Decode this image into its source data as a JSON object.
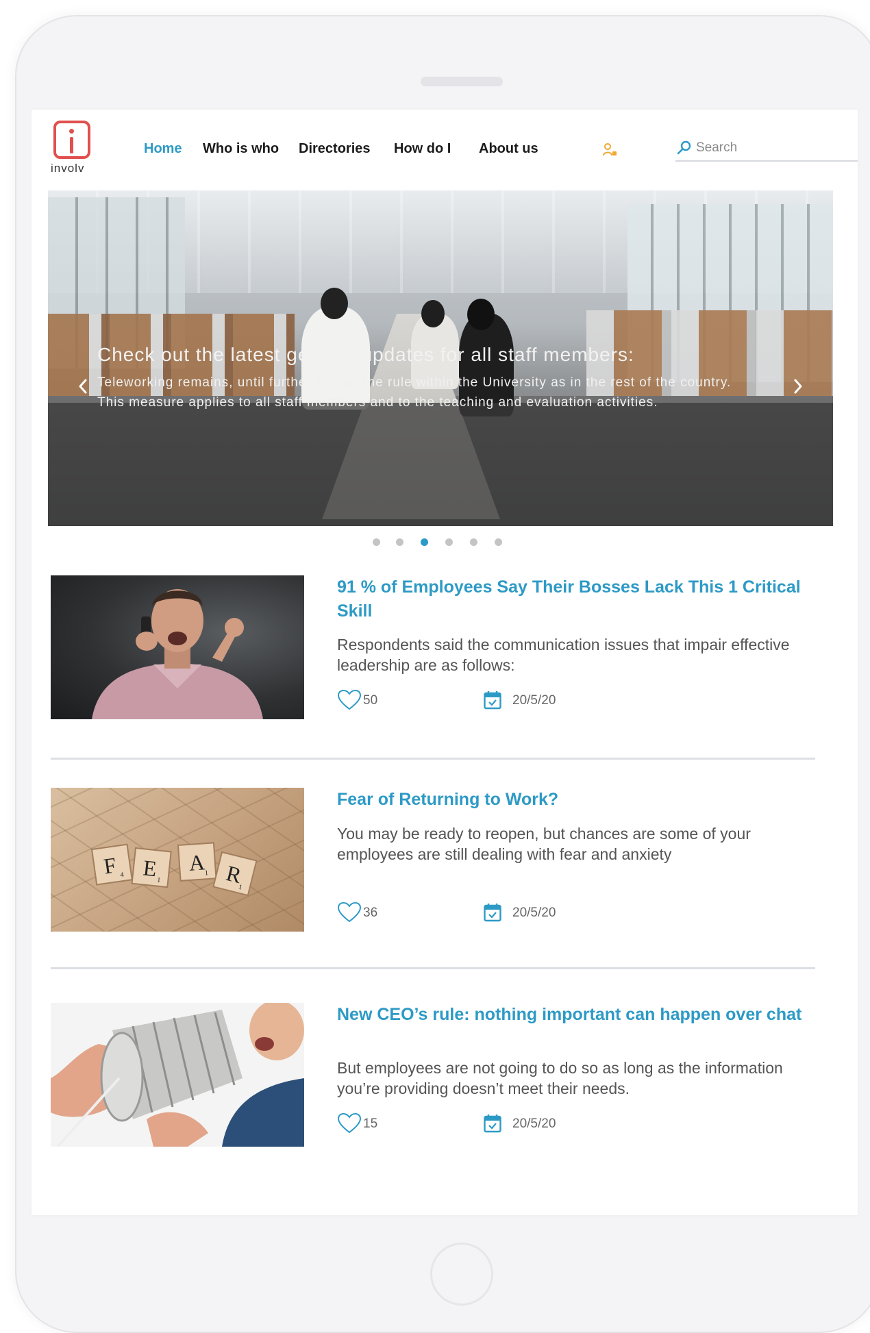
{
  "nav": {
    "logo_text": "involv",
    "items": [
      {
        "label": "Home",
        "active": true
      },
      {
        "label": "Who is who",
        "active": false
      },
      {
        "label": "Directories",
        "active": false
      },
      {
        "label": "How do I",
        "active": false
      },
      {
        "label": "About us",
        "active": false
      }
    ],
    "user_icon": "user-key-icon",
    "search_placeholder": "Search",
    "search_icon": "search-icon"
  },
  "hero": {
    "title": "Check out the latest general updates for all staff members:",
    "body": "Teleworking remains, until further notice, the rule within the University as in the rest of the country. This measure applies to all staff members and to the teaching and evaluation activities.",
    "prev_icon": "chevron-left-icon",
    "next_icon": "chevron-right-icon",
    "slide_count": 6,
    "active_slide": 3
  },
  "articles": [
    {
      "title": "91 % of  Employees Say Their Bosses Lack This 1 Critical Skill",
      "text": "Respondents said the communication issues that impair effective leadership are as follows:",
      "likes": "50",
      "date": "20/5/20",
      "image": "stressed man on phone"
    },
    {
      "title": "Fear of Returning to Work?",
      "text": "You may be ready to reopen, but chances are some of your employees are still dealing with fear and anxiety",
      "likes": "36",
      "date": "20/5/20",
      "image": "scrabble tiles spelling FEAR"
    },
    {
      "title": "New CEO’s rule: nothing important can happen over chat",
      "text": "But employees are not going to do so as long as the information you’re providing doesn’t meet their needs.",
      "likes": "15",
      "date": "20/5/20",
      "image": "tin can telephone"
    }
  ],
  "fear_tiles": [
    {
      "letter": "F",
      "points": "4"
    },
    {
      "letter": "E",
      "points": "1"
    },
    {
      "letter": "A",
      "points": "1"
    },
    {
      "letter": "R",
      "points": "1"
    }
  ],
  "colors": {
    "accent": "#2d9ac6",
    "logo": "#e0504f",
    "text": "#555555"
  }
}
